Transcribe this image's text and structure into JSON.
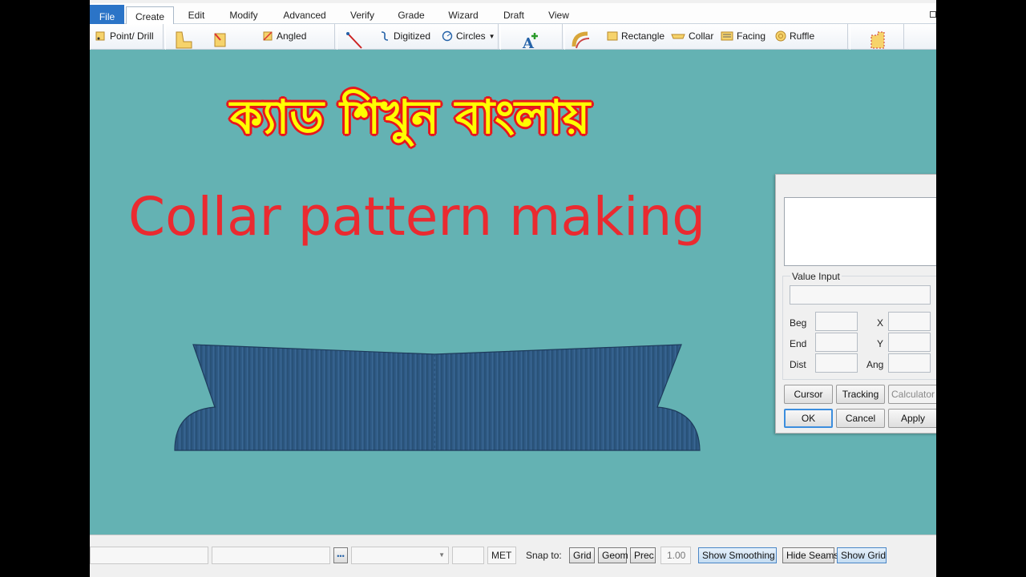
{
  "menu": {
    "tabs": [
      "File",
      "Create",
      "Edit",
      "Modify",
      "Advanced",
      "Verify",
      "Grade",
      "Wizard",
      "Draft",
      "View"
    ],
    "active": "Create"
  },
  "ribbon": {
    "point_drill": "Point/ Drill",
    "angled": "Angled",
    "digitized": "Digitized",
    "circles": "Circles",
    "rectangle": "Rectangle",
    "collar": "Collar",
    "facing": "Facing",
    "ruffle": "Ruffle"
  },
  "canvas": {
    "bengali_title": "ক্যাড শিখুন বাংলায়",
    "subtitle": "Collar pattern making",
    "background_color": "#64b2b3",
    "collar_color": "#2f5a85"
  },
  "dialog": {
    "value_input_label": "Value Input",
    "beg_label": "Beg",
    "end_label": "End",
    "dist_label": "Dist",
    "x_label": "X",
    "y_label": "Y",
    "ang_label": "Ang",
    "cursor": "Cursor",
    "tracking": "Tracking",
    "calculator": "Calculator",
    "ok": "OK",
    "cancel": "Cancel",
    "apply": "Apply"
  },
  "status": {
    "units": "MET",
    "snap_to": "Snap to:",
    "grid": "Grid",
    "geom": "Geom",
    "prec": "Prec",
    "prec_value": "1.00",
    "show_smoothing": "Show Smoothing",
    "hide_seams": "Hide Seams",
    "show_grid": "Show Grid"
  }
}
